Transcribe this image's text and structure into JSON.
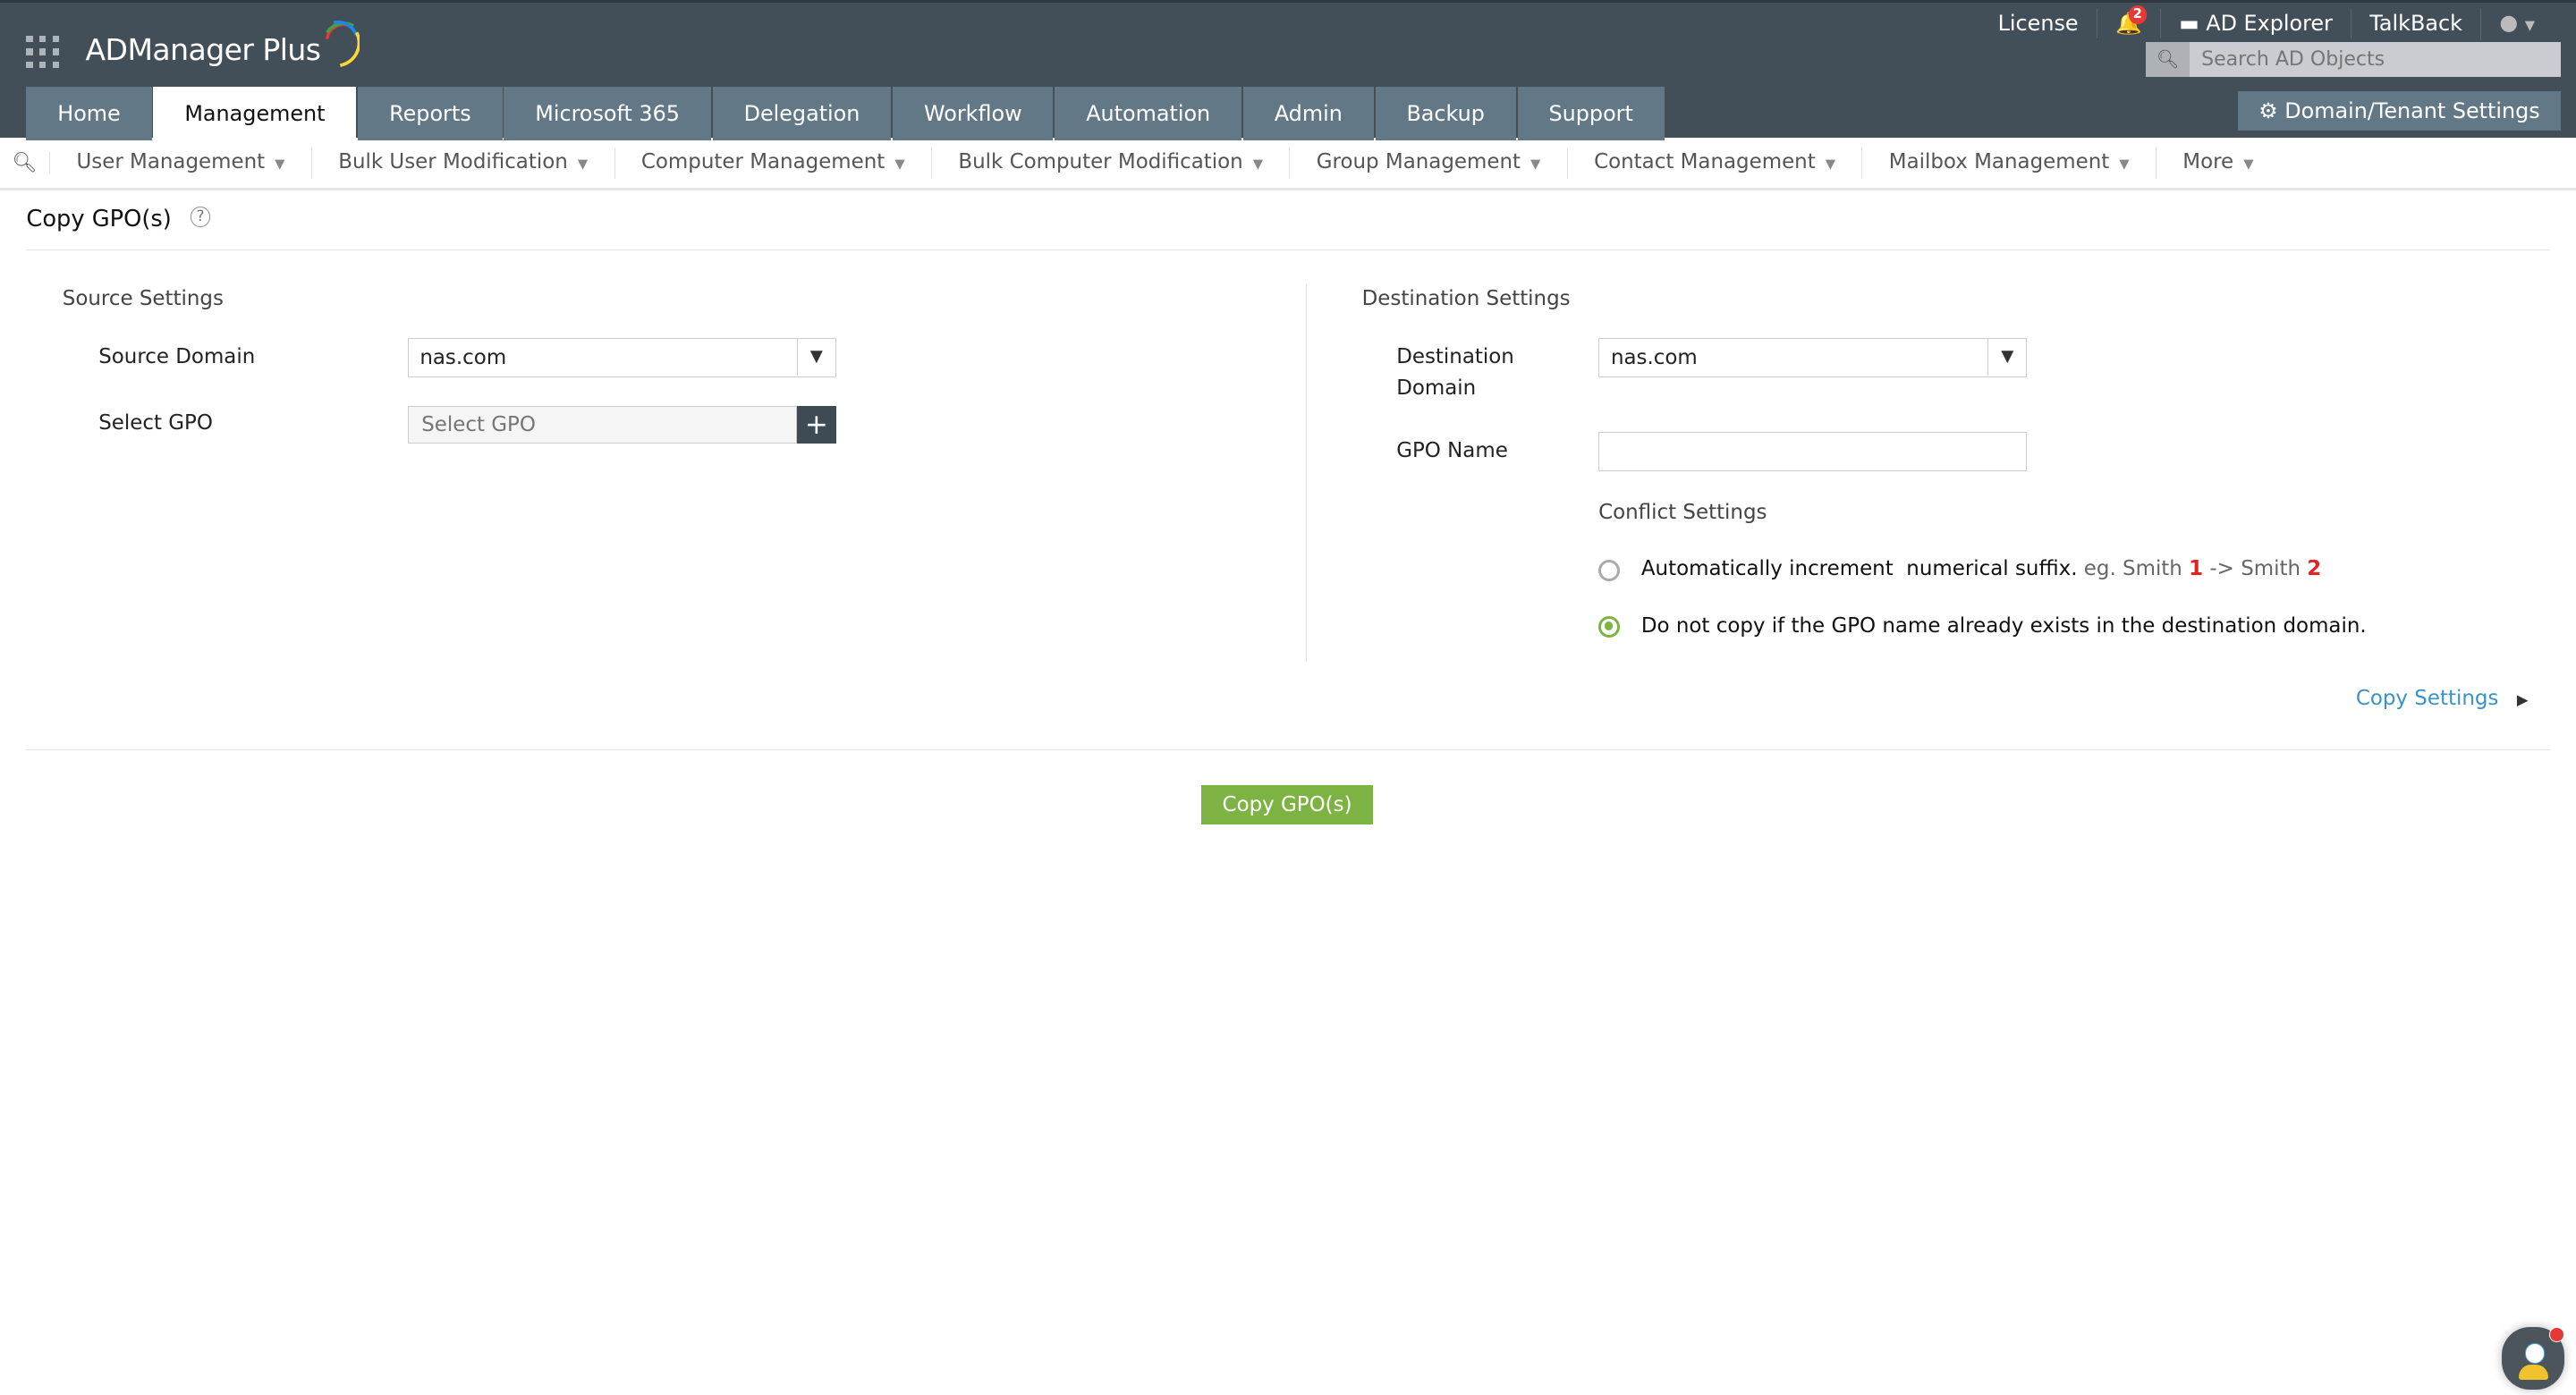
{
  "app": {
    "name": "ADManager Plus"
  },
  "top_links": {
    "license": "License",
    "notifications_count": "2",
    "ad_explorer": "AD Explorer",
    "talkback": "TalkBack"
  },
  "search": {
    "placeholder": "Search AD Objects"
  },
  "domain_settings_label": "Domain/Tenant Settings",
  "tabs": [
    {
      "label": "Home"
    },
    {
      "label": "Management"
    },
    {
      "label": "Reports"
    },
    {
      "label": "Microsoft 365"
    },
    {
      "label": "Delegation"
    },
    {
      "label": "Workflow"
    },
    {
      "label": "Automation"
    },
    {
      "label": "Admin"
    },
    {
      "label": "Backup"
    },
    {
      "label": "Support"
    }
  ],
  "active_tab": "Management",
  "subnav": [
    {
      "label": "User Management"
    },
    {
      "label": "Bulk User Modification"
    },
    {
      "label": "Computer Management"
    },
    {
      "label": "Bulk Computer Modification"
    },
    {
      "label": "Group Management"
    },
    {
      "label": "Contact Management"
    },
    {
      "label": "Mailbox Management"
    },
    {
      "label": "More"
    }
  ],
  "page": {
    "title": "Copy GPO(s)",
    "source": {
      "heading": "Source Settings",
      "domain_label": "Source Domain",
      "domain_value": "nas.com",
      "gpo_label": "Select GPO",
      "gpo_placeholder": "Select GPO"
    },
    "destination": {
      "heading": "Destination Settings",
      "domain_label_1": "Destination",
      "domain_label_2": "Domain",
      "domain_value": "nas.com",
      "gpo_name_label": "GPO Name",
      "gpo_name_value": "",
      "conflict_heading": "Conflict Settings",
      "option1": {
        "text": "Automatically increment  numerical suffix.",
        "eg": "eg. Smith ",
        "n1": "1",
        "arrow": " -> Smith ",
        "n2": "2",
        "selected": false
      },
      "option2": {
        "text": "Do not copy if the GPO name already exists in the destination domain.",
        "selected": true
      }
    },
    "copy_settings_link": "Copy Settings",
    "submit_label": "Copy GPO(s)"
  },
  "colors": {
    "header": "#434f58",
    "tab": "#627886",
    "accent_green": "#7cb342",
    "link": "#3a93c6"
  }
}
